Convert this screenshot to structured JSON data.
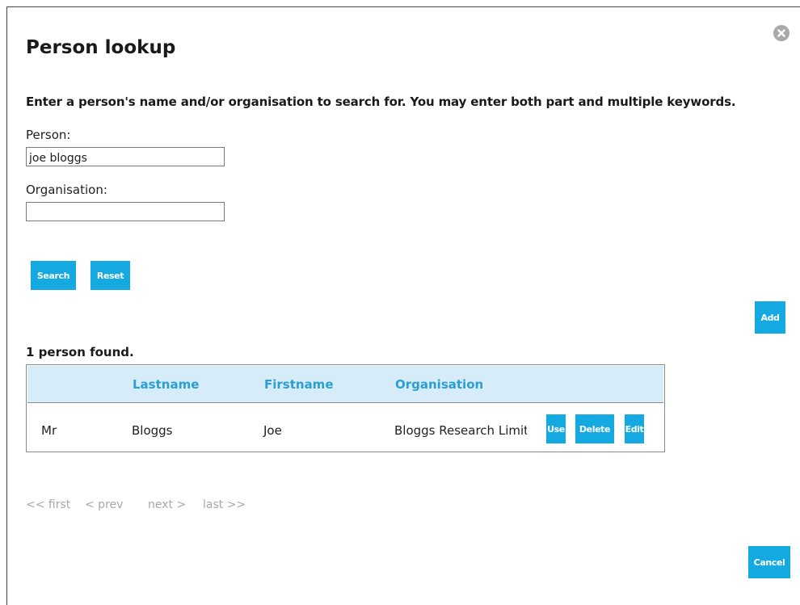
{
  "dialog": {
    "title": "Person lookup",
    "close_icon": "close-icon",
    "instructions": "Enter a person's name and/or organisation to search for. You may enter both part and multiple keywords."
  },
  "form": {
    "person_label": "Person:",
    "person_value": "joe bloggs",
    "organisation_label": "Organisation:",
    "organisation_value": "",
    "search_label": "Search",
    "reset_label": "Reset",
    "add_label": "Add"
  },
  "results": {
    "count_text": "1 person found.",
    "columns": [
      "",
      "Lastname",
      "Firstname",
      "Organisation"
    ],
    "rows": [
      {
        "title": "Mr",
        "lastname": "Bloggs",
        "firstname": "Joe",
        "organisation": "Bloggs Research Limited",
        "actions": [
          "Use",
          "Delete",
          "Edit"
        ]
      }
    ]
  },
  "pagination": {
    "first": "<< first",
    "prev": "< prev",
    "next": "next >",
    "last": "last >>"
  },
  "footer": {
    "cancel_label": "Cancel"
  },
  "colors": {
    "accent": "#14a9e0",
    "header_bg": "#d6ecf8",
    "header_text": "#2b9fd4",
    "disabled_text": "#a8a8a8"
  }
}
